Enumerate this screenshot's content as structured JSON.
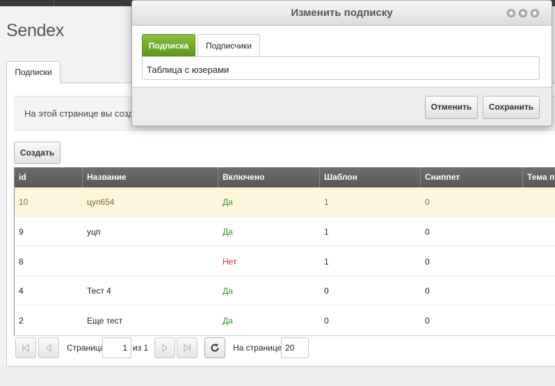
{
  "app": {
    "logo": "Sendex"
  },
  "main": {
    "tab_label": "Подписки",
    "info_text": "На этой странице вы созд",
    "create_label": "Создать"
  },
  "grid": {
    "columns": [
      "id",
      "Название",
      "Включено",
      "Шаблон",
      "Сниппет",
      "Тема п"
    ],
    "rows": [
      {
        "id": "10",
        "name": "цуп654",
        "enabled": "Да",
        "template": "1",
        "snippet": "0"
      },
      {
        "id": "9",
        "name": "уцп",
        "enabled": "Да",
        "template": "1",
        "snippet": "0"
      },
      {
        "id": "8",
        "name": "",
        "enabled": "Нет",
        "template": "1",
        "snippet": "0"
      },
      {
        "id": "4",
        "name": "Тест 4",
        "enabled": "Да",
        "template": "0",
        "snippet": "0"
      },
      {
        "id": "2",
        "name": "Еще тест",
        "enabled": "Да",
        "template": "0",
        "snippet": "0"
      }
    ]
  },
  "pager": {
    "page_label": "Страница",
    "page_value": "1",
    "of_label": "из 1",
    "per_page_label": "На странице:",
    "per_page_value": "20",
    "first_icon": "first-page-icon",
    "prev_icon": "prev-page-icon",
    "next_icon": "next-page-icon",
    "last_icon": "last-page-icon",
    "refresh_icon": "refresh-icon"
  },
  "modal": {
    "title": "Изменить подписку",
    "tabs": [
      "Подписка",
      "Подписчики"
    ],
    "content_text": "Таблица с юзерами",
    "cancel_label": "Отменить",
    "save_label": "Сохранить"
  },
  "colors": {
    "accent_green": "#6ea52b",
    "yes_color": "#2f8f2f",
    "no_color": "#d02828",
    "selected_row": "#fdf6dd",
    "header_bg": "#666666"
  }
}
